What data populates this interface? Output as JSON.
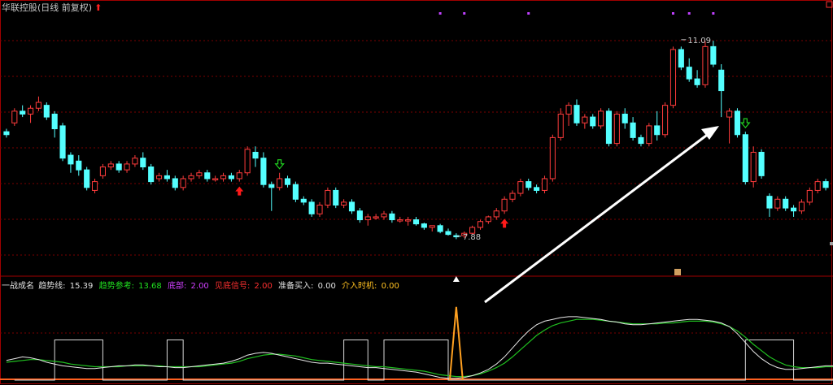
{
  "title": {
    "stock_name": "华联控股",
    "period": "(日线 前复权)",
    "arrow_icon": "red-up-arrow-icon"
  },
  "indicator_bar": {
    "name": "一战成名",
    "items": [
      {
        "label": "趋势线:",
        "value": "15.39",
        "color": "#e0e0e0"
      },
      {
        "label": "趋势参考:",
        "value": "13.68",
        "color": "#20e020"
      },
      {
        "label": "底部:",
        "value": "2.00",
        "color": "#d040ff"
      },
      {
        "label": "见底信号:",
        "value": "2.00",
        "color": "#ff3030"
      },
      {
        "label": "准备买入:",
        "value": "0.00",
        "color": "#e0e0e0"
      },
      {
        "label": "介入时机:",
        "value": "0.00",
        "color": "#ffc020"
      }
    ]
  },
  "colors": {
    "up_candle": "#ff3c3c",
    "down_candle": "#54ffff",
    "grid": "#7a0000",
    "border": "#a00000",
    "trend_line": "#e8e8e8",
    "trend_ref": "#20c020",
    "bottom_line": "#ffa020",
    "arrow": "#ffffff"
  },
  "chart_data": {
    "type": "candlestick",
    "price_range": [
      7.2,
      11.6
    ],
    "annotations": [
      {
        "text": "11.09",
        "kind": "high",
        "candle_index": 84,
        "value": 11.09
      },
      {
        "text": "7.88",
        "kind": "low",
        "candle_index": 56,
        "value": 7.88
      }
    ],
    "candles": [
      [
        9.55,
        9.6,
        9.45,
        9.5
      ],
      [
        9.7,
        9.95,
        9.65,
        9.9
      ],
      [
        9.9,
        10.0,
        9.8,
        9.85
      ],
      [
        9.85,
        10.0,
        9.7,
        9.95
      ],
      [
        9.95,
        10.15,
        9.9,
        10.05
      ],
      [
        10.0,
        10.05,
        9.75,
        9.8
      ],
      [
        9.85,
        9.9,
        9.45,
        9.6
      ],
      [
        9.65,
        9.7,
        9.05,
        9.1
      ],
      [
        9.15,
        9.2,
        8.85,
        9.0
      ],
      [
        9.05,
        9.15,
        8.8,
        8.9
      ],
      [
        8.9,
        8.95,
        8.55,
        8.6
      ],
      [
        8.55,
        8.75,
        8.5,
        8.7
      ],
      [
        8.8,
        9.0,
        8.75,
        8.95
      ],
      [
        8.95,
        9.05,
        8.9,
        9.0
      ],
      [
        9.0,
        9.05,
        8.85,
        8.9
      ],
      [
        8.9,
        9.05,
        8.85,
        9.0
      ],
      [
        9.0,
        9.15,
        8.95,
        9.1
      ],
      [
        9.1,
        9.2,
        8.9,
        8.95
      ],
      [
        8.95,
        9.0,
        8.65,
        8.7
      ],
      [
        8.75,
        8.85,
        8.7,
        8.8
      ],
      [
        8.8,
        8.9,
        8.7,
        8.75
      ],
      [
        8.75,
        8.8,
        8.55,
        8.6
      ],
      [
        8.6,
        8.8,
        8.55,
        8.75
      ],
      [
        8.75,
        8.85,
        8.7,
        8.8
      ],
      [
        8.8,
        8.9,
        8.75,
        8.85
      ],
      [
        8.85,
        8.9,
        8.7,
        8.75
      ],
      [
        8.75,
        8.8,
        8.7,
        8.75
      ],
      [
        8.75,
        8.85,
        8.7,
        8.8
      ],
      [
        8.8,
        8.85,
        8.7,
        8.75
      ],
      [
        8.75,
        8.9,
        8.7,
        8.85
      ],
      [
        8.85,
        9.3,
        8.8,
        9.25
      ],
      [
        9.2,
        9.3,
        8.95,
        9.1
      ],
      [
        9.1,
        9.2,
        8.6,
        8.65
      ],
      [
        8.65,
        8.7,
        8.2,
        8.6
      ],
      [
        8.6,
        8.85,
        8.55,
        8.75
      ],
      [
        8.75,
        8.8,
        8.6,
        8.65
      ],
      [
        8.65,
        8.7,
        8.35,
        8.4
      ],
      [
        8.4,
        8.45,
        8.3,
        8.35
      ],
      [
        8.35,
        8.4,
        8.1,
        8.15
      ],
      [
        8.15,
        8.35,
        8.1,
        8.3
      ],
      [
        8.3,
        8.6,
        8.25,
        8.55
      ],
      [
        8.55,
        8.6,
        8.25,
        8.3
      ],
      [
        8.3,
        8.4,
        8.25,
        8.35
      ],
      [
        8.35,
        8.4,
        8.15,
        8.2
      ],
      [
        8.2,
        8.25,
        8.0,
        8.05
      ],
      [
        8.05,
        8.15,
        7.95,
        8.1
      ],
      [
        8.1,
        8.15,
        8.05,
        8.1
      ],
      [
        8.1,
        8.2,
        8.05,
        8.15
      ],
      [
        8.15,
        8.2,
        8.0,
        8.05
      ],
      [
        8.05,
        8.1,
        8.0,
        8.05
      ],
      [
        8.05,
        8.1,
        7.95,
        8.05
      ],
      [
        8.05,
        8.1,
        7.95,
        7.98
      ],
      [
        7.98,
        8.0,
        7.88,
        7.92
      ],
      [
        7.92,
        7.95,
        7.85,
        7.95
      ],
      [
        7.95,
        7.98,
        7.82,
        7.85
      ],
      [
        7.85,
        7.9,
        7.78,
        7.8
      ],
      [
        7.78,
        7.82,
        7.72,
        7.76
      ],
      [
        7.78,
        7.85,
        7.74,
        7.82
      ],
      [
        7.82,
        7.95,
        7.8,
        7.92
      ],
      [
        7.92,
        8.05,
        7.88,
        8.02
      ],
      [
        8.02,
        8.12,
        7.98,
        8.1
      ],
      [
        8.1,
        8.25,
        8.05,
        8.2
      ],
      [
        8.2,
        8.45,
        8.15,
        8.4
      ],
      [
        8.4,
        8.55,
        8.35,
        8.5
      ],
      [
        8.5,
        8.75,
        8.45,
        8.7
      ],
      [
        8.7,
        8.75,
        8.55,
        8.6
      ],
      [
        8.6,
        8.65,
        8.5,
        8.55
      ],
      [
        8.55,
        8.8,
        8.5,
        8.75
      ],
      [
        8.75,
        9.5,
        8.7,
        9.45
      ],
      [
        9.45,
        9.95,
        9.4,
        9.85
      ],
      [
        9.85,
        10.05,
        9.65,
        10.0
      ],
      [
        10.0,
        10.1,
        9.65,
        9.7
      ],
      [
        9.7,
        9.85,
        9.6,
        9.8
      ],
      [
        9.8,
        9.85,
        9.6,
        9.65
      ],
      [
        9.65,
        9.95,
        9.6,
        9.9
      ],
      [
        9.9,
        9.95,
        9.3,
        9.35
      ],
      [
        9.35,
        9.9,
        9.3,
        9.85
      ],
      [
        9.85,
        9.95,
        9.6,
        9.7
      ],
      [
        9.7,
        9.8,
        9.4,
        9.45
      ],
      [
        9.45,
        9.5,
        9.3,
        9.35
      ],
      [
        9.35,
        9.7,
        9.3,
        9.65
      ],
      [
        9.65,
        9.9,
        9.4,
        9.5
      ],
      [
        9.5,
        10.05,
        9.45,
        10.0
      ],
      [
        10.0,
        11.0,
        9.95,
        10.95
      ],
      [
        10.95,
        11.0,
        10.6,
        10.65
      ],
      [
        10.65,
        10.8,
        10.4,
        10.45
      ],
      [
        10.45,
        10.6,
        10.3,
        10.35
      ],
      [
        10.35,
        11.09,
        10.3,
        11.0
      ],
      [
        11.0,
        11.1,
        10.65,
        10.7
      ],
      [
        10.6,
        10.7,
        9.8,
        10.25
      ],
      [
        9.8,
        9.95,
        9.35,
        9.9
      ],
      [
        9.9,
        9.95,
        9.45,
        9.5
      ],
      [
        9.5,
        9.55,
        8.65,
        8.7
      ],
      [
        8.7,
        9.3,
        8.6,
        9.2
      ],
      [
        9.2,
        9.25,
        8.75,
        8.8
      ],
      [
        8.45,
        8.5,
        8.1,
        8.25
      ],
      [
        8.25,
        8.45,
        8.2,
        8.4
      ],
      [
        8.4,
        8.45,
        8.2,
        8.25
      ],
      [
        8.25,
        8.3,
        8.1,
        8.2
      ],
      [
        8.2,
        8.4,
        8.15,
        8.35
      ],
      [
        8.35,
        8.6,
        8.3,
        8.55
      ],
      [
        8.55,
        8.75,
        8.5,
        8.7
      ],
      [
        8.7,
        8.75,
        8.55,
        8.6
      ]
    ],
    "markers": [
      {
        "candle_index": 29,
        "kind": "red-up-arrow-icon"
      },
      {
        "candle_index": 34,
        "kind": "green-down-arrow-icon"
      },
      {
        "candle_index": 62,
        "kind": "red-up-arrow-icon"
      },
      {
        "candle_index": 92,
        "kind": "green-down-arrow-icon"
      },
      {
        "candle_index": 56,
        "kind": "white-up-arrow-icon"
      }
    ],
    "purple_marks_index": [
      54,
      57,
      65,
      83,
      85,
      88
    ],
    "sub_indicator": {
      "range": [
        0,
        100
      ],
      "trend_line": [
        22,
        24,
        26,
        25,
        23,
        20,
        18,
        16,
        15,
        14,
        13,
        13,
        14,
        15,
        16,
        16,
        17,
        17,
        16,
        15,
        15,
        14,
        14,
        15,
        16,
        17,
        18,
        19,
        21,
        24,
        28,
        30,
        31,
        30,
        28,
        26,
        24,
        22,
        20,
        19,
        19,
        18,
        17,
        16,
        15,
        14,
        14,
        13,
        12,
        11,
        10,
        9,
        7,
        5,
        3,
        2,
        2,
        3,
        5,
        8,
        12,
        18,
        26,
        36,
        46,
        55,
        62,
        66,
        68,
        70,
        71,
        71,
        70,
        69,
        68,
        66,
        65,
        63,
        62,
        62,
        63,
        64,
        65,
        66,
        67,
        68,
        68,
        67,
        66,
        64,
        60,
        52,
        42,
        32,
        24,
        18,
        14,
        12,
        12,
        13,
        14,
        15,
        16,
        16
      ],
      "trend_ref": [
        20,
        21,
        22,
        23,
        23,
        22,
        21,
        20,
        18,
        17,
        16,
        15,
        15,
        15,
        15,
        16,
        16,
        16,
        16,
        16,
        15,
        15,
        15,
        15,
        15,
        16,
        17,
        18,
        19,
        21,
        24,
        26,
        28,
        29,
        29,
        28,
        27,
        25,
        23,
        22,
        21,
        20,
        19,
        18,
        17,
        16,
        15,
        15,
        14,
        13,
        12,
        11,
        10,
        8,
        6,
        5,
        4,
        4,
        5,
        7,
        10,
        14,
        19,
        26,
        34,
        42,
        50,
        56,
        61,
        64,
        66,
        68,
        68,
        68,
        67,
        66,
        65,
        64,
        63,
        63,
        63,
        63,
        64,
        64,
        65,
        66,
        66,
        66,
        65,
        63,
        60,
        55,
        48,
        40,
        33,
        26,
        21,
        17,
        15,
        14,
        14,
        14,
        15,
        15
      ],
      "white_step": [
        [
          1,
          6,
          0
        ],
        [
          6,
          12,
          45
        ],
        [
          12,
          20,
          0
        ],
        [
          20,
          22,
          45
        ],
        [
          22,
          42,
          0
        ],
        [
          42,
          45,
          45
        ],
        [
          45,
          47,
          0
        ],
        [
          47,
          55,
          45
        ],
        [
          55,
          92,
          0
        ],
        [
          92,
          98,
          45
        ],
        [
          98,
          104,
          0
        ]
      ],
      "orange_spike": {
        "candle_index": 56,
        "value": 82
      }
    }
  }
}
